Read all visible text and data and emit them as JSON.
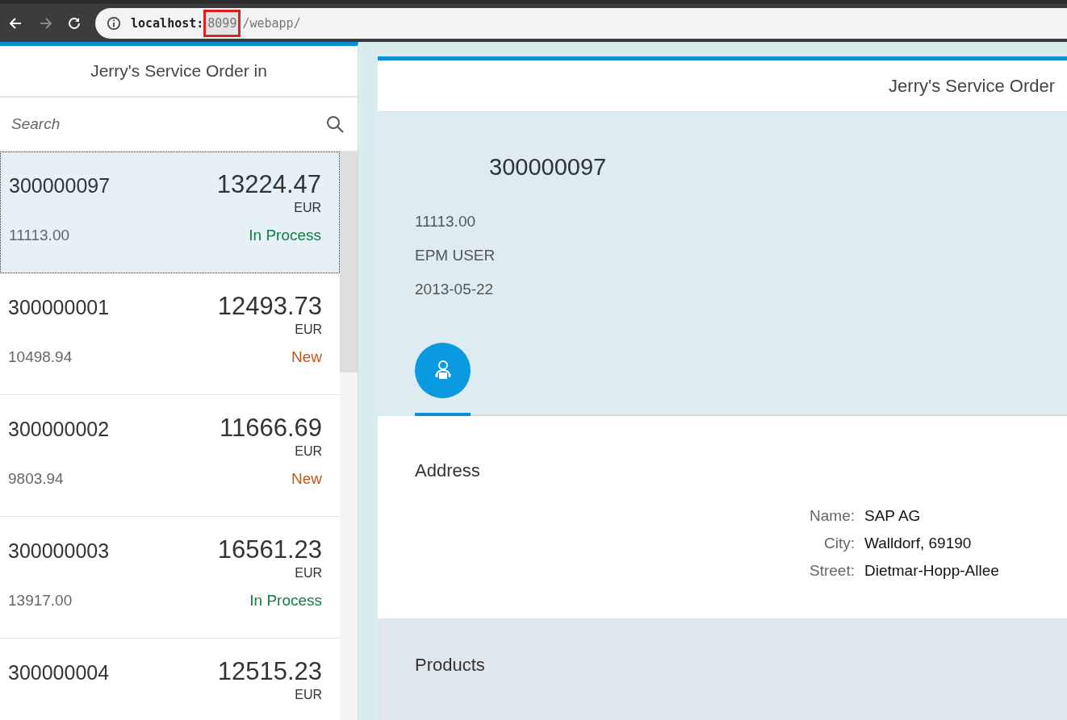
{
  "browser": {
    "url_host": "localhost:",
    "url_port": "8099",
    "url_path": "/webapp/",
    "port_highlighted": true
  },
  "master": {
    "title": "Jerry's Service Order in",
    "search": {
      "placeholder": "Search"
    },
    "items": [
      {
        "id": "300000097",
        "amount": "13224.47",
        "currency": "EUR",
        "net": "11113.00",
        "status": "In Process",
        "color": "#107e3e",
        "selected": true
      },
      {
        "id": "300000001",
        "amount": "12493.73",
        "currency": "EUR",
        "net": "10498.94",
        "status": "New",
        "color": "#c7531a",
        "selected": false
      },
      {
        "id": "300000002",
        "amount": "11666.69",
        "currency": "EUR",
        "net": "9803.94",
        "status": "New",
        "color": "#c7531a",
        "selected": false
      },
      {
        "id": "300000003",
        "amount": "16561.23",
        "currency": "EUR",
        "net": "13917.00",
        "status": "In Process",
        "color": "#107e3e",
        "selected": false
      },
      {
        "id": "300000004",
        "amount": "12515.23",
        "currency": "EUR",
        "selected": false
      }
    ]
  },
  "detail": {
    "title": "Jerry's Service Order",
    "object_title": "300000097",
    "attributes": [
      "11113.00",
      "EPM USER",
      "2013-05-22"
    ],
    "tabs": [
      {
        "selected": true
      }
    ],
    "address": {
      "heading": "Address",
      "fields": [
        {
          "label": "Name:",
          "value": "SAP AG"
        },
        {
          "label": "City:",
          "value": "Walldorf, 69190"
        },
        {
          "label": "Street:",
          "value": "Dietmar-Hopp-Allee"
        }
      ]
    },
    "products": {
      "heading": "Products"
    }
  }
}
